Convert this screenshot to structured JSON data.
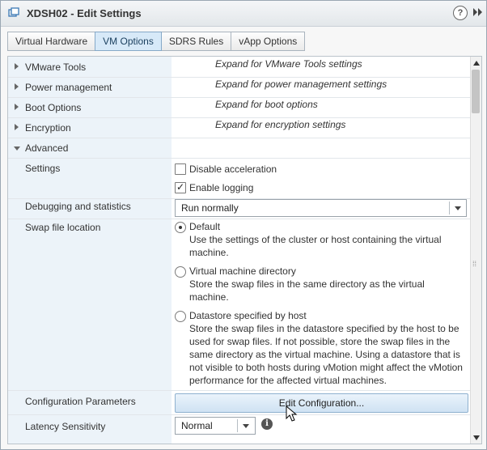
{
  "window": {
    "title": "XDSH02 - Edit Settings",
    "help": "?"
  },
  "tabs": [
    {
      "label": "Virtual Hardware",
      "active": false
    },
    {
      "label": "VM Options",
      "active": true
    },
    {
      "label": "SDRS Rules",
      "active": false
    },
    {
      "label": "vApp Options",
      "active": false
    }
  ],
  "sections": {
    "vmware_tools": {
      "label": "VMware Tools",
      "hint": "Expand for VMware Tools settings"
    },
    "power_management": {
      "label": "Power management",
      "hint": "Expand for power management settings"
    },
    "boot_options": {
      "label": "Boot Options",
      "hint": "Expand for boot options"
    },
    "encryption": {
      "label": "Encryption",
      "hint": "Expand for encryption settings"
    },
    "advanced": {
      "label": "Advanced"
    }
  },
  "advanced": {
    "settings_label": "Settings",
    "disable_acceleration": {
      "label": "Disable acceleration",
      "checked": false
    },
    "enable_logging": {
      "label": "Enable logging",
      "checked": true
    },
    "debugging_label": "Debugging and statistics",
    "debugging_value": "Run normally",
    "swap_label": "Swap file location",
    "swap_options": [
      {
        "label": "Default",
        "selected": true,
        "desc1": "Use the settings of the cluster or host containing the virtual",
        "desc2": "machine."
      },
      {
        "label": "Virtual machine directory",
        "selected": false,
        "desc1": "Store the swap files in the same directory as the virtual",
        "desc2": "machine."
      },
      {
        "label": "Datastore specified by host",
        "selected": false,
        "desc1": "Store the swap files in the datastore specified by the host to be",
        "desc2": "used for swap files. If not possible, store the swap files in the",
        "desc3": "same directory as the virtual machine. Using a datastore that is",
        "desc4": "not visible to both hosts during vMotion might affect the vMotion",
        "desc5": "performance for the affected virtual machines."
      }
    ],
    "config_params_label": "Configuration Parameters",
    "edit_config_button": "Edit Configuration...",
    "latency_label": "Latency Sensitivity",
    "latency_value": "Normal"
  },
  "colors": {
    "label_column": "#ecf3f9",
    "active_tab": "#d7e9f8",
    "button": "#cfe2f3"
  }
}
